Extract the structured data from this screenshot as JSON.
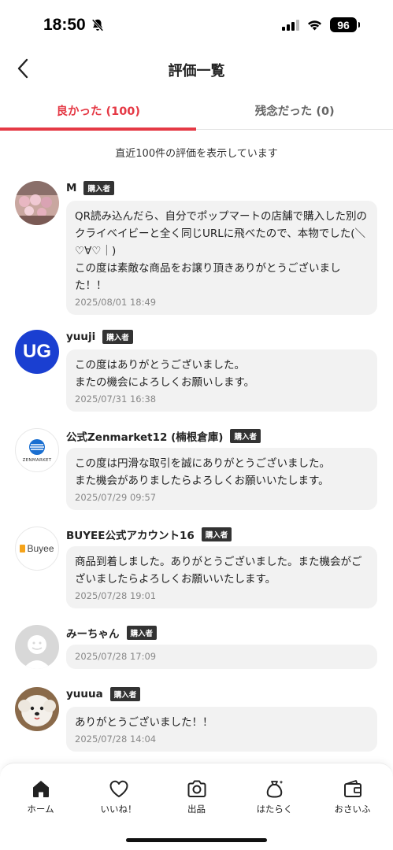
{
  "status_bar": {
    "time": "18:50",
    "battery": "96"
  },
  "header": {
    "title": "評価一覧"
  },
  "tabs": [
    {
      "label": "良かった (100)",
      "active": true
    },
    {
      "label": "残念だった (0)",
      "active": false
    }
  ],
  "summary_text": "直近100件の評価を表示しています",
  "buyer_badge": "購入者",
  "reviews": [
    {
      "name": "M",
      "text": "QR読み込んだら、自分でポップマートの店舗で購入した別のクライベイビーと全く同じURLに飛べたので、本物でした(＼♡∀♡｜)\nこの度は素敵な商品をお譲り頂きありがとうございました！！",
      "date": "2025/08/01 18:49"
    },
    {
      "name": "yuuji",
      "text": "この度はありがとうございました。\nまたの機会によろしくお願いします。",
      "date": "2025/07/31 16:38",
      "avatar_text": "UG"
    },
    {
      "name": "公式Zenmarket12 (楠根倉庫)",
      "text": "この度は円滑な取引を誠にありがとうございました。\nまた機会がありましたらよろしくお願いいたします。",
      "date": "2025/07/29 09:57",
      "avatar_text": "ZENMARKET"
    },
    {
      "name": "BUYEE公式アカウント16",
      "text": "商品到着しました。ありがとうございました。また機会がございましたらよろしくお願いいたします。",
      "date": "2025/07/28 19:01",
      "avatar_text": "Buyee"
    },
    {
      "name": "みーちゃん",
      "text": "",
      "date": "2025/07/28 17:09"
    },
    {
      "name": "yuuua",
      "text": "ありがとうございました！！",
      "date": "2025/07/28 14:04"
    }
  ],
  "bottom_nav": [
    {
      "label": "ホーム",
      "icon": "home-icon"
    },
    {
      "label": "いいね！",
      "icon": "heart-icon"
    },
    {
      "label": "出品",
      "icon": "camera-icon"
    },
    {
      "label": "はたらく",
      "icon": "money-bag-icon"
    },
    {
      "label": "おさいふ",
      "icon": "wallet-icon"
    }
  ],
  "colors": {
    "accent": "#e53945",
    "ug_blue": "#1a3fd1",
    "buyee_orange": "#f5a31a"
  }
}
